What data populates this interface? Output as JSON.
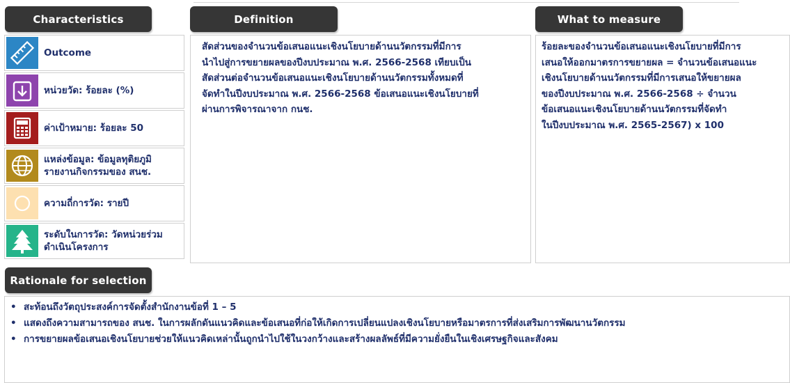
{
  "headers": {
    "characteristics": "Characteristics",
    "definition": "Definition",
    "what_to_measure": "What to measure",
    "rationale": "Rationale for selection"
  },
  "characteristics": [
    {
      "icon": "ruler-icon",
      "color": "#2c86c5",
      "label": "Outcome"
    },
    {
      "icon": "download-arrow-icon",
      "color": "#8e44ad",
      "label": "หน่วยวัด: ร้อยละ (%)"
    },
    {
      "icon": "calculator-icon",
      "color": "#a41d1d",
      "label": "ค่าเป้าหมาย: ร้อยละ 50"
    },
    {
      "icon": "globe-icon",
      "color": "#b28a1d",
      "label": "แหล่งข้อมูล: ข้อมูลทุติยภูมิ\nรายงานกิจกรรมของ สนช."
    },
    {
      "icon": "circle-icon",
      "color": "#fde0b0",
      "label": "ความถี่การวัด: รายปี"
    },
    {
      "icon": "tree-icon",
      "color": "#25b48a",
      "label": "ระดับในการวัด: วัดหน่วยร่วม\nดำเนินโครงการ"
    }
  ],
  "definition": "สัดส่วนของจำนวนข้อเสนอแนะเชิงนโยบายด้านนวัตกรรมที่มีการ\nนำไปสู่การขยายผลของปีงบประมาณ พ.ศ. 2566-2568 เทียบเป็น\nสัดส่วนต่อจำนวนข้อเสนอแนะเชิงนโยบายด้านนวัตกรรมทั้งหมดที่\nจัดทำในปีงบประมาณ พ.ศ. 2566-2568 ข้อเสนอแนะเชิงนโยบายที่\nผ่านการพิจารณาจาก กนช.",
  "what_to_measure": "ร้อยละของจำนวนข้อเสนอแนะเชิงนโยบายที่มีการ\nเสนอให้ออกมาตรการขยายผล = จำนวนข้อเสนอแนะ\nเชิงนโยบายด้านนวัตกรรมที่มีการเสนอให้ขยายผล\nของปีงบประมาณ พ.ศ. 2566-2568 ÷ จำนวน\nข้อเสนอแนะเชิงนโยบายด้านนวัตกรรมที่จัดทำ\nในปีงบประมาณ พ.ศ. 2565-2567) x 100",
  "rationale": [
    "สะท้อนถึงวัตถุประสงค์การจัดตั้งสำนักงานข้อที่ 1 – 5",
    "แสดงถึงความสามารถของ สนช. ในการผลักดันแนวคิดและข้อเสนอที่ก่อให้เกิดการเปลี่ยนแปลงเชิงนโยบายหรือมาตรการที่ส่งเสริมการพัฒนานวัตกรรม",
    "การขยายผลข้อเสนอเชิงนโยบายช่วยให้แนวคิดเหล่านั้นถูกนำไปใช้ในวงกว้างและสร้างผลลัพธ์ที่มีความยั่งยืนในเชิงเศรษฐกิจและสังคม"
  ],
  "bullet": "•"
}
